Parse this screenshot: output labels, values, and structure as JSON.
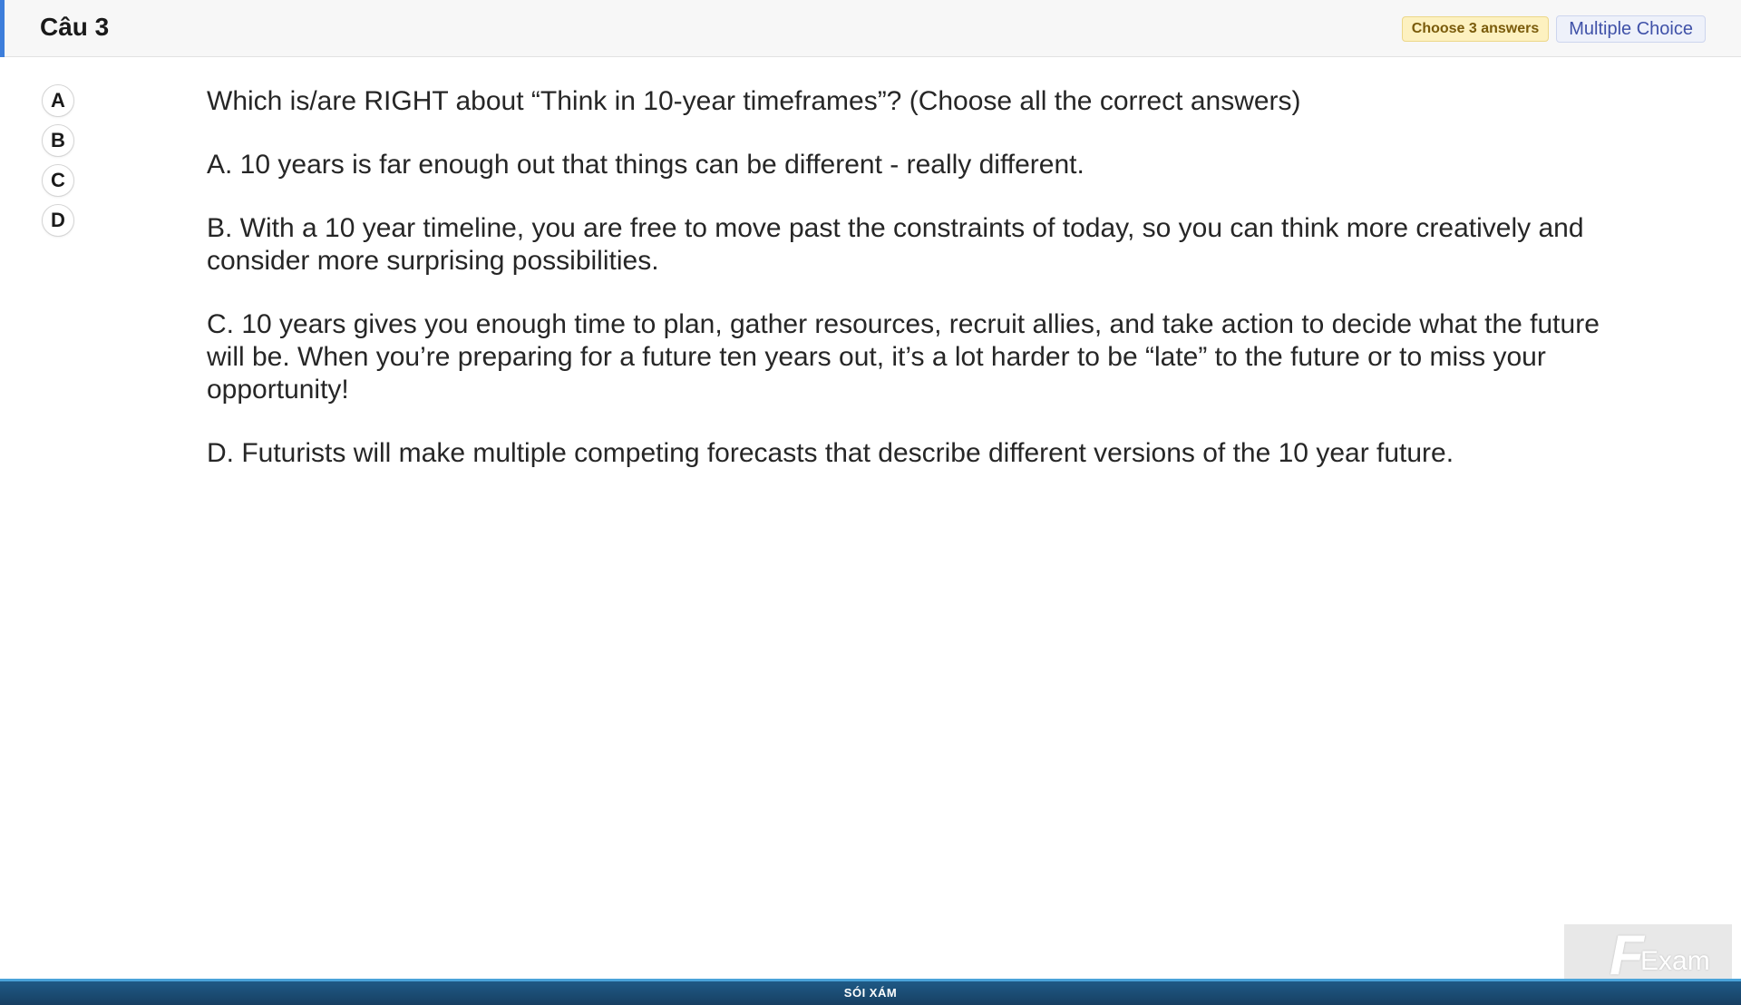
{
  "header": {
    "title": "Câu 3",
    "badge_count": "Choose 3 answers",
    "badge_type": "Multiple Choice",
    "accent_color": "#3d7edb"
  },
  "options": [
    "A",
    "B",
    "C",
    "D"
  ],
  "question": {
    "stem": "Which is/are RIGHT about “Think in 10-year timeframes”? (Choose all the correct answers)",
    "answers": [
      "A.  10 years is far enough out that things can be different - really different.",
      "B.  With a 10 year timeline, you are free to move past the constraints of today, so you can think more creatively and consider more surprising possibilities.",
      "C.  10 years gives you enough time to plan, gather resources, recruit allies, and take action to decide what the future will be. When you’re preparing for a future ten years out, it’s a lot harder to be “late” to the future or to miss your opportunity!",
      "D.  Futurists will make multiple competing forecasts that describe different versions of the 10 year future."
    ]
  },
  "logo": {
    "mark": "F",
    "text": "Exam"
  },
  "footer": {
    "text": "SÓI XÁM"
  }
}
